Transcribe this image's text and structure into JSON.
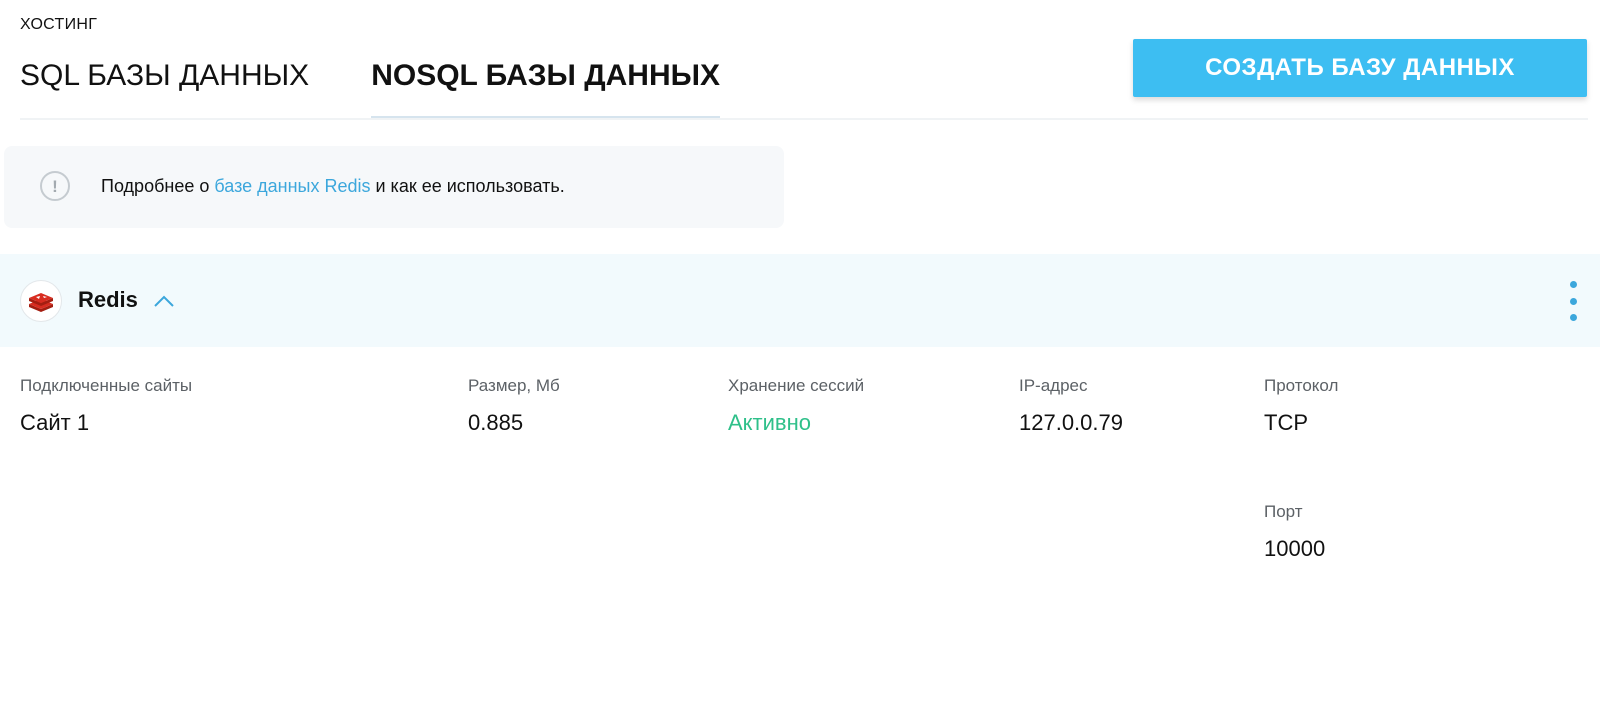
{
  "breadcrumb": "ХОСТИНГ",
  "tabs": [
    {
      "label": "SQL БАЗЫ ДАННЫХ",
      "active": false
    },
    {
      "label": "NOSQL БАЗЫ ДАННЫХ",
      "active": true
    }
  ],
  "create_button": "СОЗДАТЬ БАЗУ ДАННЫХ",
  "info": {
    "before": "Подробнее о ",
    "link": "базе данных Redis",
    "after": " и как ее использовать."
  },
  "database": {
    "name": "Redis",
    "fields": {
      "sites": {
        "label": "Подключенные сайты",
        "value": "Сайт 1"
      },
      "size": {
        "label": "Размер, Мб",
        "value": "0.885"
      },
      "sessions": {
        "label": "Хранение сессий",
        "value": "Активно"
      },
      "ip": {
        "label": "IP-адрес",
        "value": "127.0.0.79"
      },
      "protocol": {
        "label": "Протокол",
        "value": "TCP"
      },
      "port": {
        "label": "Порт",
        "value": "10000"
      }
    }
  },
  "colors": {
    "accent": "#3dbef2",
    "link": "#3ca7dc",
    "active_status": "#2fc08a",
    "header_bg": "#f2fafd",
    "redis_logo": "#d82c20"
  },
  "icons": {
    "info": "exclamation-circle-icon",
    "logo": "redis-logo-icon",
    "collapse": "chevron-up-icon",
    "menu": "kebab-menu-icon"
  }
}
